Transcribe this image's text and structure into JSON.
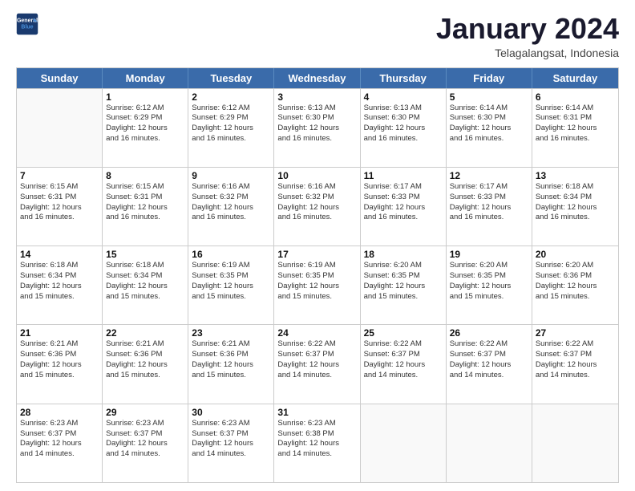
{
  "header": {
    "logo_line1": "General",
    "logo_line2": "Blue",
    "month": "January 2024",
    "location": "Telagalangsat, Indonesia"
  },
  "weekdays": [
    "Sunday",
    "Monday",
    "Tuesday",
    "Wednesday",
    "Thursday",
    "Friday",
    "Saturday"
  ],
  "rows": [
    [
      {
        "day": "",
        "info": ""
      },
      {
        "day": "1",
        "info": "Sunrise: 6:12 AM\nSunset: 6:29 PM\nDaylight: 12 hours\nand 16 minutes."
      },
      {
        "day": "2",
        "info": "Sunrise: 6:12 AM\nSunset: 6:29 PM\nDaylight: 12 hours\nand 16 minutes."
      },
      {
        "day": "3",
        "info": "Sunrise: 6:13 AM\nSunset: 6:30 PM\nDaylight: 12 hours\nand 16 minutes."
      },
      {
        "day": "4",
        "info": "Sunrise: 6:13 AM\nSunset: 6:30 PM\nDaylight: 12 hours\nand 16 minutes."
      },
      {
        "day": "5",
        "info": "Sunrise: 6:14 AM\nSunset: 6:30 PM\nDaylight: 12 hours\nand 16 minutes."
      },
      {
        "day": "6",
        "info": "Sunrise: 6:14 AM\nSunset: 6:31 PM\nDaylight: 12 hours\nand 16 minutes."
      }
    ],
    [
      {
        "day": "7",
        "info": "Sunrise: 6:15 AM\nSunset: 6:31 PM\nDaylight: 12 hours\nand 16 minutes."
      },
      {
        "day": "8",
        "info": "Sunrise: 6:15 AM\nSunset: 6:31 PM\nDaylight: 12 hours\nand 16 minutes."
      },
      {
        "day": "9",
        "info": "Sunrise: 6:16 AM\nSunset: 6:32 PM\nDaylight: 12 hours\nand 16 minutes."
      },
      {
        "day": "10",
        "info": "Sunrise: 6:16 AM\nSunset: 6:32 PM\nDaylight: 12 hours\nand 16 minutes."
      },
      {
        "day": "11",
        "info": "Sunrise: 6:17 AM\nSunset: 6:33 PM\nDaylight: 12 hours\nand 16 minutes."
      },
      {
        "day": "12",
        "info": "Sunrise: 6:17 AM\nSunset: 6:33 PM\nDaylight: 12 hours\nand 16 minutes."
      },
      {
        "day": "13",
        "info": "Sunrise: 6:18 AM\nSunset: 6:34 PM\nDaylight: 12 hours\nand 16 minutes."
      }
    ],
    [
      {
        "day": "14",
        "info": "Sunrise: 6:18 AM\nSunset: 6:34 PM\nDaylight: 12 hours\nand 15 minutes."
      },
      {
        "day": "15",
        "info": "Sunrise: 6:18 AM\nSunset: 6:34 PM\nDaylight: 12 hours\nand 15 minutes."
      },
      {
        "day": "16",
        "info": "Sunrise: 6:19 AM\nSunset: 6:35 PM\nDaylight: 12 hours\nand 15 minutes."
      },
      {
        "day": "17",
        "info": "Sunrise: 6:19 AM\nSunset: 6:35 PM\nDaylight: 12 hours\nand 15 minutes."
      },
      {
        "day": "18",
        "info": "Sunrise: 6:20 AM\nSunset: 6:35 PM\nDaylight: 12 hours\nand 15 minutes."
      },
      {
        "day": "19",
        "info": "Sunrise: 6:20 AM\nSunset: 6:35 PM\nDaylight: 12 hours\nand 15 minutes."
      },
      {
        "day": "20",
        "info": "Sunrise: 6:20 AM\nSunset: 6:36 PM\nDaylight: 12 hours\nand 15 minutes."
      }
    ],
    [
      {
        "day": "21",
        "info": "Sunrise: 6:21 AM\nSunset: 6:36 PM\nDaylight: 12 hours\nand 15 minutes."
      },
      {
        "day": "22",
        "info": "Sunrise: 6:21 AM\nSunset: 6:36 PM\nDaylight: 12 hours\nand 15 minutes."
      },
      {
        "day": "23",
        "info": "Sunrise: 6:21 AM\nSunset: 6:36 PM\nDaylight: 12 hours\nand 15 minutes."
      },
      {
        "day": "24",
        "info": "Sunrise: 6:22 AM\nSunset: 6:37 PM\nDaylight: 12 hours\nand 14 minutes."
      },
      {
        "day": "25",
        "info": "Sunrise: 6:22 AM\nSunset: 6:37 PM\nDaylight: 12 hours\nand 14 minutes."
      },
      {
        "day": "26",
        "info": "Sunrise: 6:22 AM\nSunset: 6:37 PM\nDaylight: 12 hours\nand 14 minutes."
      },
      {
        "day": "27",
        "info": "Sunrise: 6:22 AM\nSunset: 6:37 PM\nDaylight: 12 hours\nand 14 minutes."
      }
    ],
    [
      {
        "day": "28",
        "info": "Sunrise: 6:23 AM\nSunset: 6:37 PM\nDaylight: 12 hours\nand 14 minutes."
      },
      {
        "day": "29",
        "info": "Sunrise: 6:23 AM\nSunset: 6:37 PM\nDaylight: 12 hours\nand 14 minutes."
      },
      {
        "day": "30",
        "info": "Sunrise: 6:23 AM\nSunset: 6:37 PM\nDaylight: 12 hours\nand 14 minutes."
      },
      {
        "day": "31",
        "info": "Sunrise: 6:23 AM\nSunset: 6:38 PM\nDaylight: 12 hours\nand 14 minutes."
      },
      {
        "day": "",
        "info": ""
      },
      {
        "day": "",
        "info": ""
      },
      {
        "day": "",
        "info": ""
      }
    ]
  ]
}
